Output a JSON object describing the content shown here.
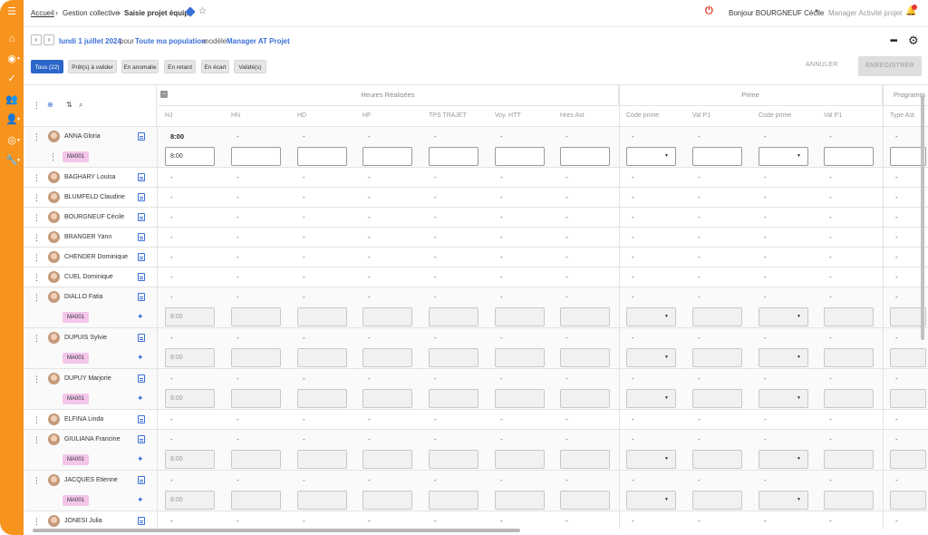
{
  "header": {
    "breadcrumb": [
      "Accueil",
      "Gestion collective",
      "Saisie projet équipe"
    ],
    "greeting": "Bonjour BOURGNEUF Cécile",
    "profile": "Manager Activité projet"
  },
  "toolbar": {
    "date": "lundi 1 juillet 2024",
    "for_label": "pour",
    "population": "Toute ma population",
    "model_label": "modèle",
    "model": "Manager AT Projet",
    "filters": [
      "Tous (22)",
      "Prêt(s) à valider",
      "En anomalie",
      "En retard",
      "En écart",
      "Validé(s)"
    ],
    "active_filter": 0,
    "cancel": "ANNULER",
    "save": "ENREGISTRER"
  },
  "grid": {
    "groups": [
      "Heures Réalisées",
      "Prime",
      "Programm"
    ],
    "columns": [
      "HJ",
      "HN",
      "HD",
      "HF",
      "TPS TRAJET",
      "Voy. HTT",
      "Hres Ast",
      "Code prime",
      "Val P1",
      "Code prime",
      "Val P1",
      "Type Ast"
    ],
    "dash": "-",
    "tag": "MA001",
    "rows": [
      {
        "name": "ANNA Gloria",
        "expanded": true,
        "hj": "8:00",
        "input": "8:00",
        "editable": true
      },
      {
        "name": "BAGHARY Louisa",
        "expanded": false
      },
      {
        "name": "BLUMFELD Claudine",
        "expanded": false
      },
      {
        "name": "BOURGNEUF Cécile",
        "expanded": false
      },
      {
        "name": "BRANGER Yann",
        "expanded": false
      },
      {
        "name": "CHENDER Dominique",
        "expanded": false
      },
      {
        "name": "CUEL Dominique",
        "expanded": false
      },
      {
        "name": "DIALLO Fatia",
        "expanded": true,
        "input": "8:00",
        "editable": false
      },
      {
        "name": "DUPUIS Sylvie",
        "expanded": true,
        "input": "8:00",
        "editable": false
      },
      {
        "name": "DUPUY Marjorie",
        "expanded": true,
        "input": "8:00",
        "editable": false
      },
      {
        "name": "ELFINA Linda",
        "expanded": false
      },
      {
        "name": "GIULIANA Francine",
        "expanded": true,
        "input": "8:00",
        "editable": false
      },
      {
        "name": "JACQUES Etienne",
        "expanded": true,
        "input": "8:00",
        "editable": false
      },
      {
        "name": "JONESI Julia",
        "expanded": false
      }
    ]
  },
  "icons": {
    "sidebar": [
      "menu-icon",
      "home-icon",
      "user-circle-icon",
      "check-icon",
      "team-icon",
      "user-settings-icon",
      "eye-icon",
      "wrench-icon"
    ],
    "accent": "#f7941d",
    "primary": "#2b67c9"
  }
}
